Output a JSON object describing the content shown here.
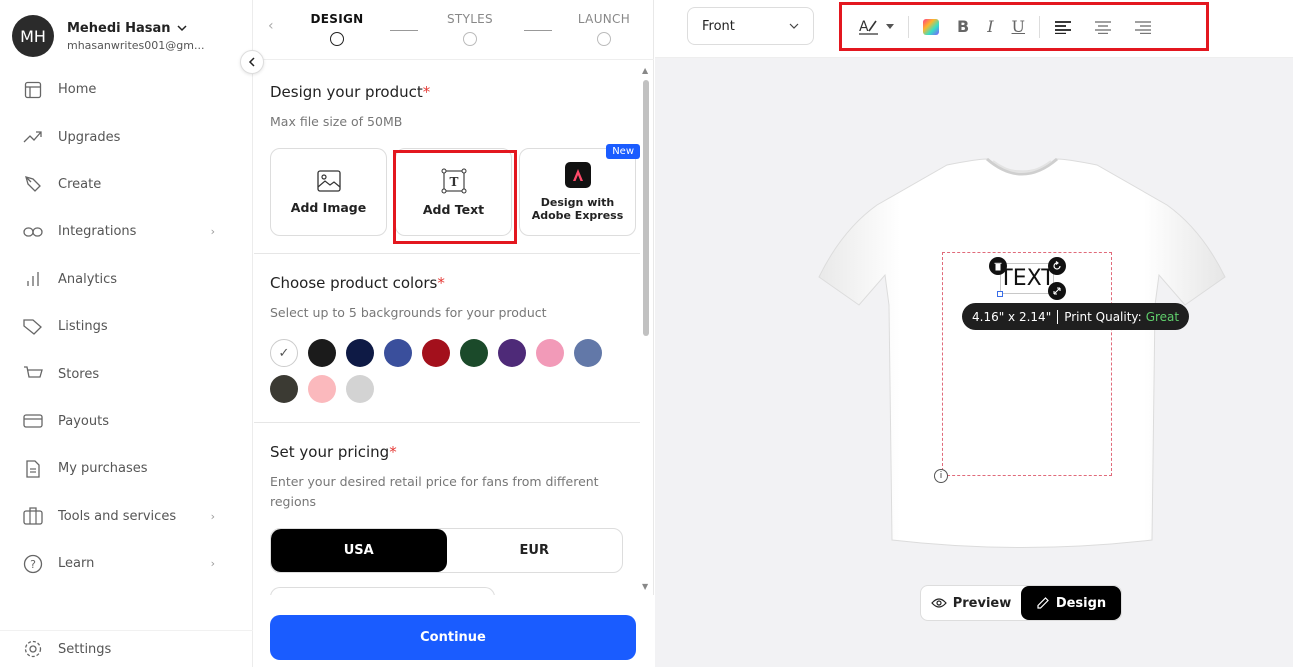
{
  "profile": {
    "initials": "MH",
    "name": "Mehedi Hasan",
    "email": "mhasanwrites001@gm..."
  },
  "nav": [
    {
      "label": "Home",
      "icon": "home-icon",
      "has_chevron": false
    },
    {
      "label": "Upgrades",
      "icon": "trend-up-icon",
      "has_chevron": false
    },
    {
      "label": "Create",
      "icon": "brush-icon",
      "has_chevron": false
    },
    {
      "label": "Integrations",
      "icon": "link-icon",
      "has_chevron": true
    },
    {
      "label": "Analytics",
      "icon": "bar-chart-icon",
      "has_chevron": false
    },
    {
      "label": "Listings",
      "icon": "tag-icon",
      "has_chevron": false
    },
    {
      "label": "Stores",
      "icon": "cart-icon",
      "has_chevron": false
    },
    {
      "label": "Payouts",
      "icon": "card-icon",
      "has_chevron": false
    },
    {
      "label": "My purchases",
      "icon": "document-icon",
      "has_chevron": false
    },
    {
      "label": "Tools and services",
      "icon": "toolbox-icon",
      "has_chevron": true
    },
    {
      "label": "Learn",
      "icon": "question-icon",
      "has_chevron": true
    }
  ],
  "settings_label": "Settings",
  "steps": [
    {
      "label": "DESIGN",
      "active": true
    },
    {
      "label": "STYLES",
      "active": false
    },
    {
      "label": "LAUNCH",
      "active": false
    }
  ],
  "design_section": {
    "title": "Design your product",
    "required_mark": "*",
    "subtitle": "Max file size of 50MB",
    "options": [
      {
        "label": "Add Image",
        "icon": "image-icon"
      },
      {
        "label": "Add Text",
        "icon": "text-box-icon"
      },
      {
        "label": "Design with Adobe Express",
        "label_line1": "Design with",
        "label_line2": "Adobe Express",
        "icon": "adobe-express-icon",
        "badge": "New"
      }
    ]
  },
  "colors_section": {
    "title": "Choose product colors",
    "required_mark": "*",
    "subtitle": "Select up to 5 backgrounds for your product",
    "swatches": [
      "#ffffff",
      "#1b1b1b",
      "#0e1a45",
      "#3a4f9c",
      "#a3101c",
      "#1b4a2a",
      "#4e2a78",
      "#f29ab8",
      "#6278a8",
      "#3b3a33",
      "#fbb9bd",
      "#d3d3d3"
    ],
    "selected_index": 0
  },
  "pricing_section": {
    "title": "Set your pricing",
    "required_mark": "*",
    "subtitle": "Enter your desired retail price for fans from different regions",
    "currencies": [
      {
        "label": "USA",
        "active": true
      },
      {
        "label": "EUR",
        "active": false
      }
    ]
  },
  "continue_label": "Continue",
  "canvas": {
    "view_select": "Front",
    "text_object": "TEXT",
    "dimensions": "4.16\" x 2.14\"",
    "quality_label": "Print Quality:",
    "quality_value": "Great",
    "info_glyph": "i",
    "modes": [
      {
        "label": "Preview",
        "icon": "eye-icon",
        "active": false
      },
      {
        "label": "Design",
        "icon": "pencil-icon",
        "active": true
      }
    ]
  },
  "toolbar": {
    "font_icon": "font-style-icon",
    "color_icon": "color-gradient-icon",
    "bold": "B",
    "italic": "I",
    "underline": "U",
    "align": [
      "align-left-icon",
      "align-center-icon",
      "align-right-icon"
    ]
  },
  "colors": {
    "accent": "#1a5cff",
    "highlight": "#e3171f",
    "quality_good": "#5fce6b"
  }
}
